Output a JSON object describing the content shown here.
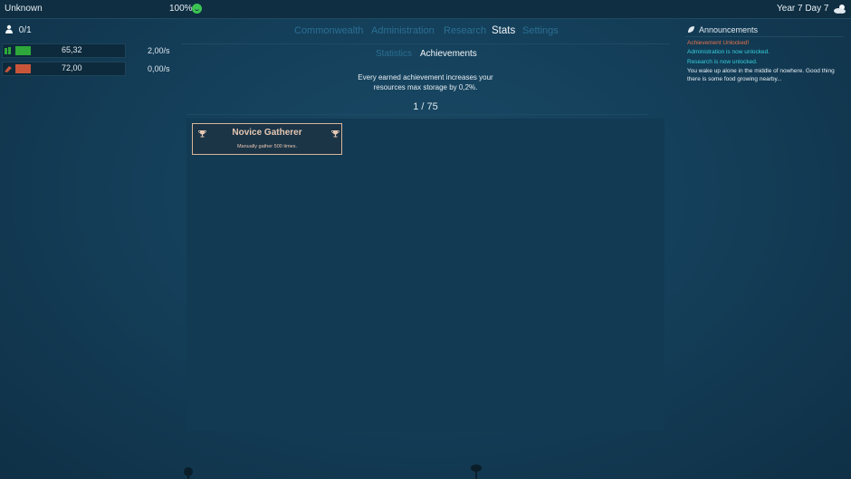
{
  "topbar": {
    "location": "Unknown",
    "happiness": "100%",
    "date": "Year 7 Day 7"
  },
  "population": "0/1",
  "resources": [
    {
      "amount": "65,32",
      "rate": "2,00/s",
      "color": "#2ea83a"
    },
    {
      "amount": "72,00",
      "rate": "0,00/s",
      "color": "#c8553a"
    }
  ],
  "nav": {
    "tabs": [
      "Commonwealth",
      "Administration",
      "Research",
      "Stats",
      "Settings"
    ],
    "active": "Stats",
    "subtabs": [
      "Statistics",
      "Achievements"
    ],
    "active_sub": "Achievements"
  },
  "achievements": {
    "description_line1": "Every earned achievement increases your",
    "description_line2": "resources max storage by 0,2%.",
    "counter": "1 / 75",
    "items": [
      {
        "title": "Novice Gatherer",
        "subtitle": "Manually gather 500 times."
      }
    ]
  },
  "announcements": {
    "title": "Announcements",
    "items": [
      {
        "text": "Achievement Unlocked!",
        "color": "#e8734a"
      },
      {
        "text": "Administration is now unlocked.",
        "color": "#34d0dc"
      },
      {
        "text": "Research is now unlocked.",
        "color": "#34d0dc"
      },
      {
        "text": "You wake up alone in the middle of nowhere. Good thing there is some food growing nearby...",
        "color": "#e6eef3"
      }
    ]
  },
  "icons": {
    "person": "person-icon",
    "smile": "smile-icon",
    "weather": "cloud-sun-icon",
    "trophy": "trophy-icon",
    "leaf": "leaf-icon",
    "food": "plant-icon",
    "wood": "log-icon"
  }
}
